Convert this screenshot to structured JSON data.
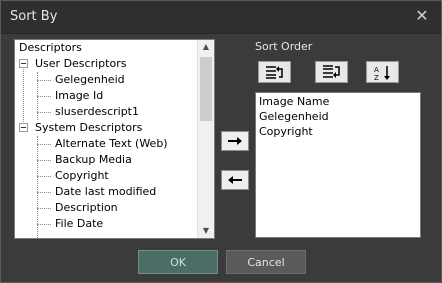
{
  "window": {
    "title": "Sort By",
    "close_glyph": "✕"
  },
  "descriptors_tree": {
    "items": [
      {
        "label": "Descriptors"
      },
      {
        "label": "User Descriptors"
      },
      {
        "label": "Gelegenheid"
      },
      {
        "label": "Image Id"
      },
      {
        "label": "sluserdescript1"
      },
      {
        "label": "System Descriptors"
      },
      {
        "label": "Alternate Text (Web)"
      },
      {
        "label": "Backup Media"
      },
      {
        "label": "Copyright"
      },
      {
        "label": "Date last modified"
      },
      {
        "label": "Description"
      },
      {
        "label": "File Date"
      }
    ],
    "scroll_up_glyph": "▲",
    "scroll_down_glyph": "▼"
  },
  "sort_order": {
    "label": "Sort Order",
    "items": [
      "Image Name",
      "Gelegenheid",
      "Copyright"
    ],
    "tools": [
      {
        "name": "move-up-icon"
      },
      {
        "name": "move-down-icon"
      },
      {
        "name": "sort-alpha-icon"
      }
    ]
  },
  "buttons": {
    "ok": "OK",
    "cancel": "Cancel"
  },
  "colors": {
    "dialog_bg": "#3b3b3b",
    "titlebar_bg": "#2f2f2f",
    "ok_bg": "#4b6d66",
    "cancel_bg": "#5a5a5a"
  }
}
